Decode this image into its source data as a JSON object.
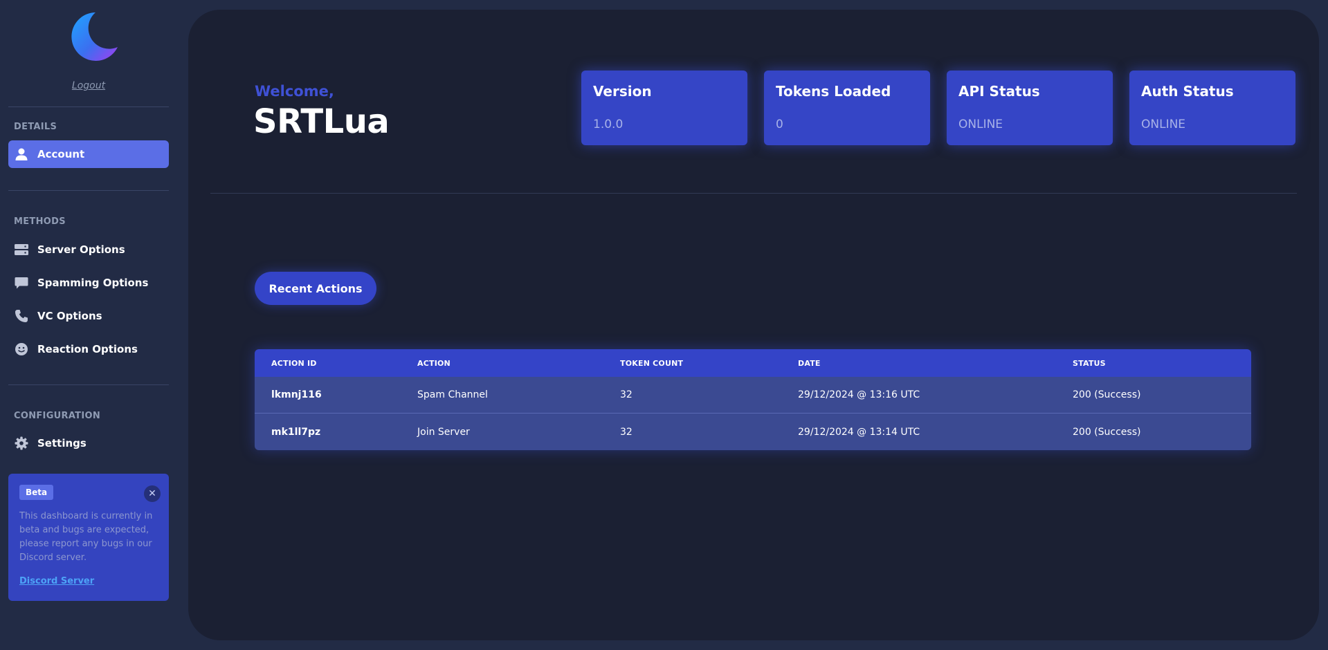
{
  "sidebar": {
    "logout_label": "Logout",
    "sections": {
      "details": "DETAILS",
      "methods": "METHODS",
      "configuration": "CONFIGURATION"
    },
    "items": {
      "account": "Account",
      "server_options": "Server Options",
      "spamming_options": "Spamming Options",
      "vc_options": "VC Options",
      "reaction_options": "Reaction Options",
      "settings": "Settings"
    },
    "beta": {
      "badge": "Beta",
      "close": "✕",
      "text": "This dashboard is currently in beta and bugs are expected, please report any bugs in our Discord server.",
      "link": "Discord Server"
    }
  },
  "header": {
    "welcome": "Welcome,",
    "username": "SRTLua"
  },
  "stats": [
    {
      "title": "Version",
      "value": "1.0.0"
    },
    {
      "title": "Tokens Loaded",
      "value": "0"
    },
    {
      "title": "API Status",
      "value": "ONLINE"
    },
    {
      "title": "Auth Status",
      "value": "ONLINE"
    }
  ],
  "recent_actions": {
    "button_label": "Recent Actions",
    "columns": [
      "ACTION ID",
      "ACTION",
      "TOKEN COUNT",
      "DATE",
      "STATUS"
    ],
    "rows": [
      [
        "lkmnj116",
        "Spam Channel",
        "32",
        "29/12/2024 @ 13:16 UTC",
        "200 (Success)"
      ],
      [
        "mk1ll7pz",
        "Join Server",
        "32",
        "29/12/2024 @ 13:14 UTC",
        "200 (Success)"
      ]
    ]
  },
  "colors": {
    "accent": "#3444c8",
    "active_nav": "#5b6ee6",
    "panel_bg": "#1b2033",
    "sidebar_bg": "#222b45",
    "link": "#4da3f7"
  }
}
